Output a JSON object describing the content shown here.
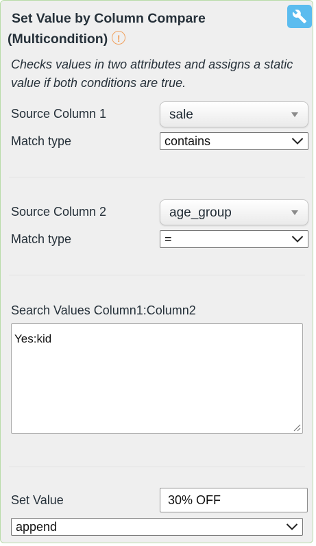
{
  "header": {
    "title_line1": "Set Value by Column Compare",
    "title_line2": "(Multicondition)",
    "warning_icon": "exclamation-circle-icon",
    "settings_icon": "wrench-icon",
    "accent_color": "#5bbcef",
    "warning_color": "#f0a15e"
  },
  "description": "Checks values in two attributes and assigns a static value if both conditions are true.",
  "condition1": {
    "source_label": "Source Column 1",
    "source_value": "sale",
    "match_label": "Match type",
    "match_value": "contains"
  },
  "condition2": {
    "source_label": "Source Column 2",
    "source_value": "age_group",
    "match_label": "Match type",
    "match_value": "="
  },
  "search": {
    "label": "Search Values Column1:Column2",
    "value": "Yes:kid"
  },
  "set_value": {
    "label": "Set Value",
    "value": "30% OFF",
    "mode": "append"
  }
}
